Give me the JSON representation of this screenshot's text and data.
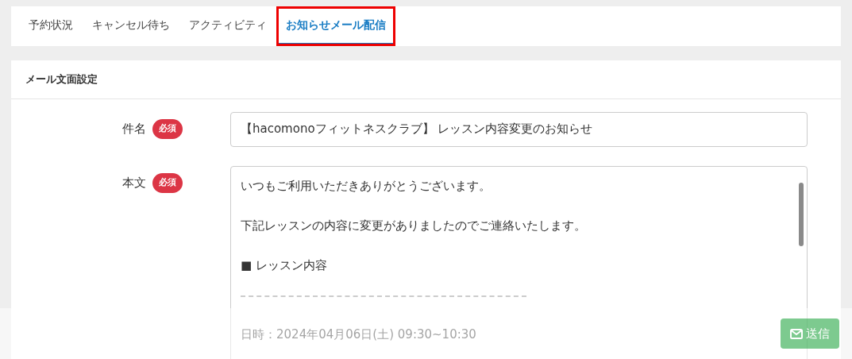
{
  "tabs": [
    {
      "label": "予約状況",
      "selected": false,
      "highlighted": false
    },
    {
      "label": "キャンセル待ち",
      "selected": false,
      "highlighted": false
    },
    {
      "label": "アクティビティ",
      "selected": false,
      "highlighted": false
    },
    {
      "label": "お知らせメール配信",
      "selected": true,
      "highlighted": true
    }
  ],
  "card": {
    "title": "メール文面設定",
    "fields": [
      {
        "label": "件名",
        "required_badge": "必須",
        "kind": "input",
        "value": "【hacomonoフィットネスクラブ】 レッスン内容変更のお知らせ"
      },
      {
        "label": "本文",
        "required_badge": "必須",
        "kind": "textarea",
        "lines": [
          {
            "kind": "text",
            "text": "いつもご利用いただきありがとうございます。"
          },
          {
            "kind": "text",
            "text": "下記レッスンの内容に変更がありましたのでご連絡いたします。"
          },
          {
            "kind": "text",
            "text": "■ レッスン内容"
          },
          {
            "kind": "separator"
          },
          {
            "kind": "text",
            "text": "日時：2024年04月06日(土) 09:30~10:30"
          }
        ]
      }
    ]
  },
  "footer": {
    "send_button": {
      "label": "送信",
      "disabled": true
    }
  }
}
